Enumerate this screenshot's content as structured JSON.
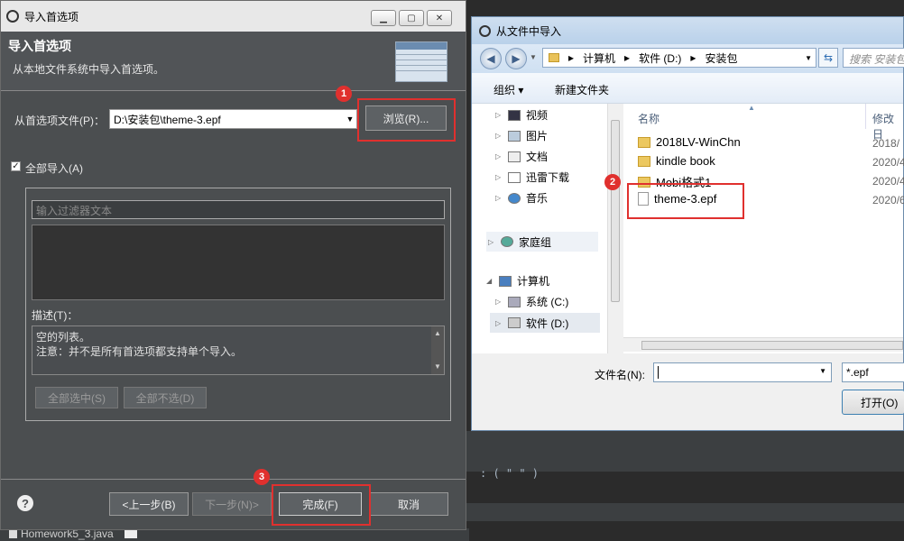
{
  "ide": {
    "code_snippet": ": ( \" \" )",
    "tab_label": "Homework5_3.java"
  },
  "left_dialog": {
    "title": "导入首选项",
    "header_title": "导入首选项",
    "header_subtitle": "从本地文件系统中导入首选项。",
    "file_label": "从首选项文件(P)：",
    "file_value": "D:\\安装包\\theme-3.epf",
    "browse_label": "浏览(R)...",
    "import_all_label": "全部导入(A)",
    "filter_placeholder": "输入过滤器文本",
    "desc_label": "描述(T)：",
    "desc_line1": "空的列表。",
    "desc_line2": "注意：并不是所有首选项都支持单个导入。",
    "select_all_label": "全部选中(S)",
    "deselect_all_label": "全部不选(D)",
    "back_label": "<上一步(B)",
    "next_label": "下一步(N)>",
    "finish_label": "完成(F)",
    "cancel_label": "取消",
    "help": "?"
  },
  "right_dialog": {
    "title": "从文件中导入",
    "breadcrumb": [
      "计算机",
      "软件 (D:)",
      "安装包"
    ],
    "search_placeholder": "搜索 安装包",
    "organize_label": "组织 ▾",
    "new_folder_label": "新建文件夹",
    "tree": [
      "视频",
      "图片",
      "文档",
      "迅雷下载",
      "音乐",
      "家庭组",
      "计算机",
      "系统 (C:)",
      "软件 (D:)"
    ],
    "col_name": "名称",
    "col_modified": "修改日",
    "files": [
      {
        "name": "2018LV-WinChn",
        "date": "2018/",
        "kind": "folder"
      },
      {
        "name": "kindle book",
        "date": "2020/4",
        "kind": "folder"
      },
      {
        "name": "Mobi格式1",
        "date": "2020/4",
        "kind": "folder"
      },
      {
        "name": "theme-3.epf",
        "date": "2020/6",
        "kind": "file"
      }
    ],
    "filename_label": "文件名(N):",
    "filetype_value": "*.epf",
    "open_label": "打开(O)"
  },
  "badges": [
    "1",
    "2",
    "3"
  ]
}
